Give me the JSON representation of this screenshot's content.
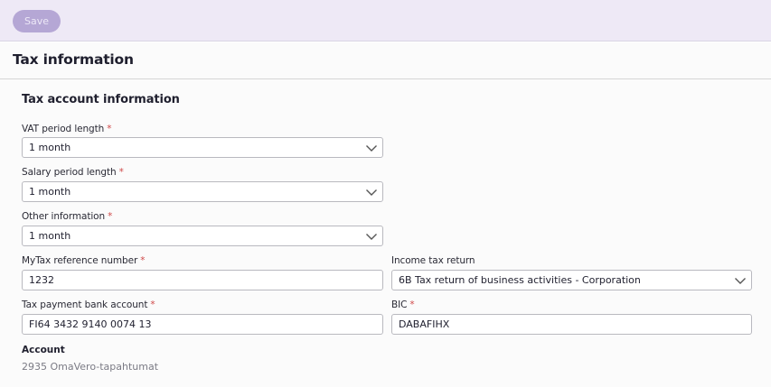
{
  "toolbar": {
    "save_label": "Save"
  },
  "section": {
    "title": "Tax information"
  },
  "tax_account": {
    "title": "Tax account information",
    "vat_period": {
      "label": "VAT period length",
      "required_mark": "*",
      "value": "1 month"
    },
    "salary_period": {
      "label": "Salary period length",
      "required_mark": "*",
      "value": "1 month"
    },
    "other_info": {
      "label": "Other information",
      "required_mark": "*",
      "value": "1 month"
    },
    "mytax_ref": {
      "label": "MyTax reference number",
      "required_mark": "*",
      "value": "1232"
    },
    "income_tax_return": {
      "label": "Income tax return",
      "value": "6B Tax return of business activities - Corporation"
    },
    "bank_account": {
      "label": "Tax payment bank account",
      "required_mark": "*",
      "value": "FI64 3432 9140 0074 13"
    },
    "bic": {
      "label": "BIC",
      "required_mark": "*",
      "value": "DABAFIHX"
    },
    "account": {
      "label": "Account",
      "value": "2935 OmaVero-tapahtumat"
    }
  },
  "icons": {
    "dropdown": "chevron-down-icon"
  },
  "colors": {
    "accent": "#b5a7d5",
    "toolbar_bg": "#eee9f6",
    "required": "#d04a4a"
  }
}
